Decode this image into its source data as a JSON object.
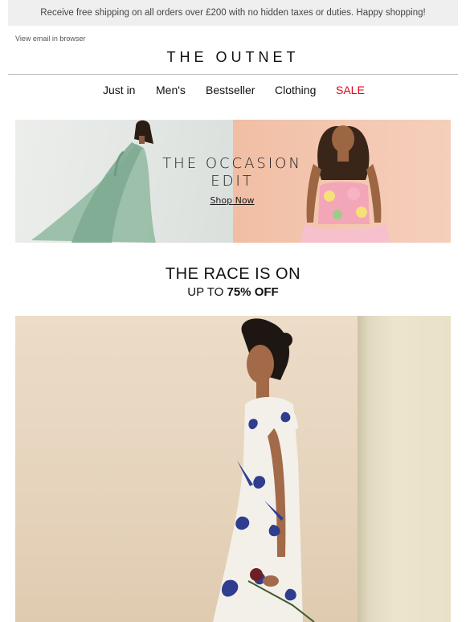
{
  "topbar": {
    "text": "Receive free shipping on all orders over £200 with no hidden taxes or duties. Happy shopping!"
  },
  "header": {
    "view_in_browser": "View email in browser",
    "logo": "THE OUTNET"
  },
  "nav": {
    "items": [
      {
        "label": "Just in"
      },
      {
        "label": "Men's"
      },
      {
        "label": "Bestseller"
      },
      {
        "label": "Clothing"
      },
      {
        "label": "SALE",
        "color": "#e3001b"
      }
    ]
  },
  "banner": {
    "title_line1": "THE OCCASION",
    "title_line2": "EDIT",
    "link": "Shop Now"
  },
  "promo": {
    "headline": "THE RACE IS ON",
    "subhead_prefix": "UP TO",
    "subhead_bold": "75% OFF"
  }
}
